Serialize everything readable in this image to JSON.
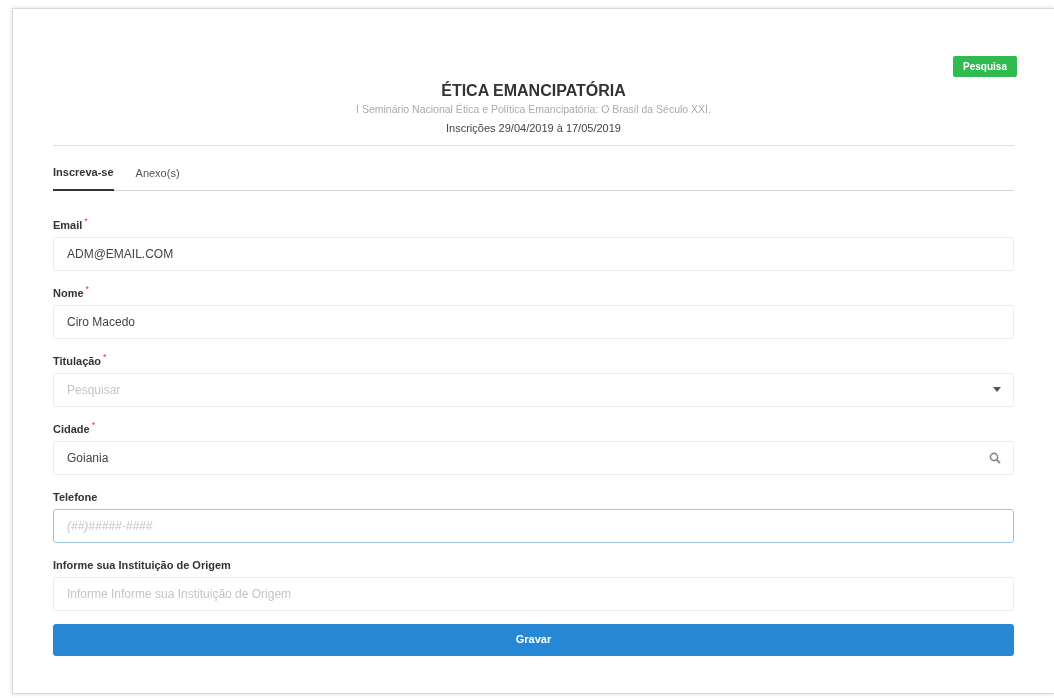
{
  "header": {
    "action_button": "Pesquisa",
    "title": "ÉTICA EMANCIPATÓRIA",
    "subtitle": "I Seminário Nacional Ética e Política Emancipatória: O Brasil da Século XXI.",
    "dates": "Inscrições 29/04/2019 à 17/05/2019"
  },
  "tabs": [
    {
      "label": "Inscreva-se",
      "selected": true
    },
    {
      "label": "Anexo(s)",
      "selected": false
    }
  ],
  "fields": [
    {
      "label": "Email",
      "required_mark": "*",
      "kind": "text",
      "value": "ADM@EMAIL.COM",
      "focused": false
    },
    {
      "label": "Nome",
      "required_mark": "*",
      "kind": "text",
      "value": "Ciro Macedo",
      "focused": false
    },
    {
      "label": "Titulação",
      "required_mark": "*",
      "kind": "select",
      "placeholder": "Pesquisar",
      "focused": false
    },
    {
      "label": "Cidade",
      "required_mark": "*",
      "kind": "search",
      "value": "Goiania",
      "focused": false
    },
    {
      "label": "Telefone",
      "kind": "text",
      "placeholder": "(##)#####-####",
      "focused": true
    },
    {
      "label": "Informe sua Instituição de Origem",
      "kind": "text",
      "placeholder": "Informe Informe sua Instituição de Origem",
      "focused": false
    }
  ],
  "submit_button": "Gravar"
}
